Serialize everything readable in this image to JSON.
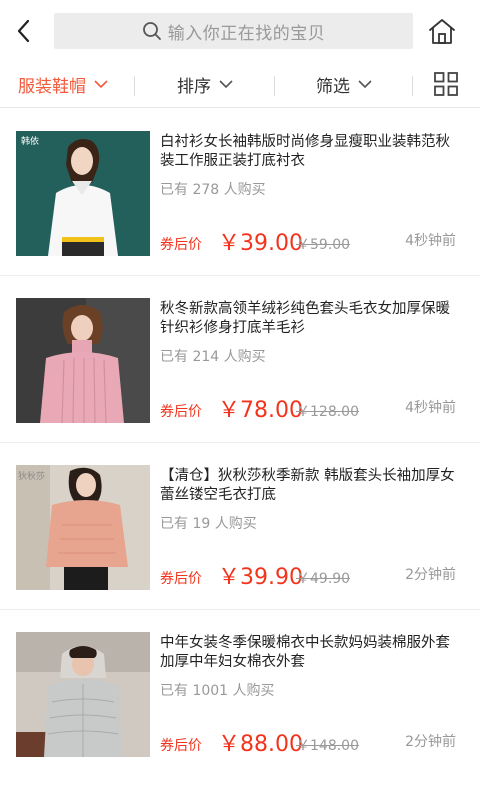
{
  "header": {
    "search_placeholder": "输入你正在找的宝贝"
  },
  "filters": {
    "category": "服装鞋帽",
    "sort": "排序",
    "filter": "筛选"
  },
  "items": [
    {
      "title": "白衬衫女长袖韩版时尚修身显瘦职业装韩范秋装工作服正装打底衬衣",
      "sold": "已有 278 人购买",
      "price_label": "券后价",
      "price": "￥39.00",
      "original_price": "￥59.00",
      "time": "4秒钟前",
      "image_tag": "韩依"
    },
    {
      "title": "秋冬新款高领羊绒衫纯色套头毛衣女加厚保暖针织衫修身打底羊毛衫",
      "sold": "已有 214 人购买",
      "price_label": "券后价",
      "price": "￥78.00",
      "original_price": "￥128.00",
      "time": "4秒钟前"
    },
    {
      "title": "【清仓】狄秋莎秋季新款 韩版套头长袖加厚女蕾丝镂空毛衣打底",
      "sold": "已有 19 人购买",
      "price_label": "券后价",
      "price": "￥39.90",
      "original_price": "￥49.90",
      "time": "2分钟前",
      "image_tag": "狄秋莎"
    },
    {
      "title": "中年女装冬季保暖棉衣中长款妈妈装棉服外套加厚中年妇女棉衣外套",
      "sold": "已有 1001 人购买",
      "price_label": "券后价",
      "price": "￥88.00",
      "original_price": "￥148.00",
      "time": "2分钟前"
    }
  ],
  "colors": {
    "accent": "#f25a3c",
    "price": "#f2341d"
  }
}
